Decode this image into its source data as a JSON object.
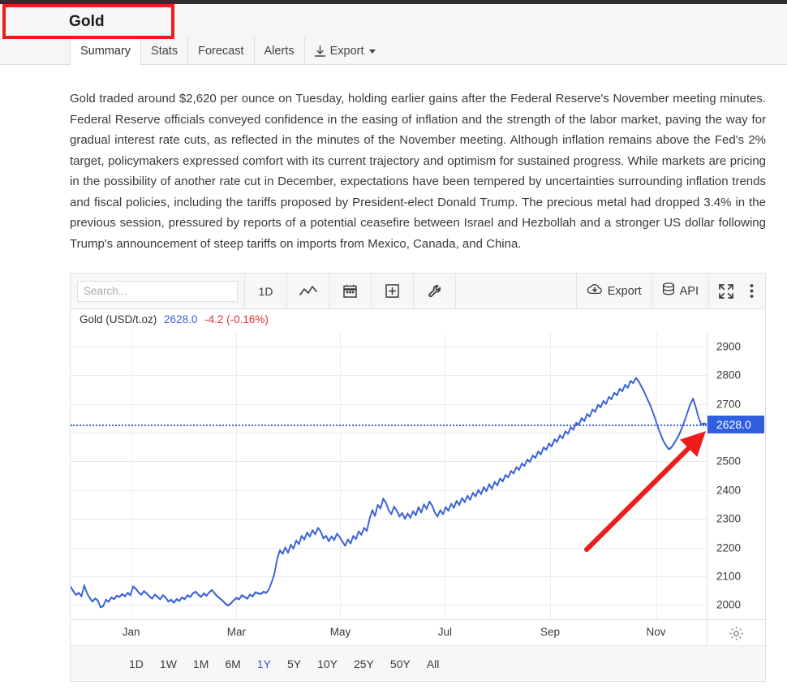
{
  "header": {
    "title": "Gold"
  },
  "tabs": [
    {
      "label": "Summary",
      "active": true
    },
    {
      "label": "Stats",
      "active": false
    },
    {
      "label": "Forecast",
      "active": false
    },
    {
      "label": "Alerts",
      "active": false
    },
    {
      "label": "Export",
      "active": false,
      "icon": "download-icon",
      "caret": true
    }
  ],
  "article": {
    "body": "Gold traded around $2,620 per ounce on Tuesday, holding earlier gains after the Federal Reserve's November meeting minutes. Federal Reserve officials conveyed confidence in the easing of inflation and the strength of the labor market, paving the way for gradual interest rate cuts, as reflected in the minutes of the November meeting. Although inflation remains above the Fed's 2% target, policymakers expressed comfort with its current trajectory and optimism for sustained progress. While markets are pricing in the possibility of another rate cut in December, expectations have been tempered by uncertainties surrounding inflation trends and fiscal policies, including the tariffs proposed by President-elect Donald Trump. The precious metal had dropped 3.4% in the previous session, pressured by reports of a potential ceasefire between Israel and Hezbollah and a stronger US dollar following Trump's announcement of steep tariffs on imports from Mexico, Canada, and China."
  },
  "chart_toolbar": {
    "search_placeholder": "Search...",
    "search_value": "",
    "interval_label": "1D",
    "icons": [
      "line-chart-icon",
      "calendar-icon",
      "plus-box-icon",
      "wrench-icon"
    ],
    "export_label": "Export",
    "export_icon": "cloud-download-icon",
    "api_label": "API",
    "api_icon": "database-icon",
    "fullscreen_icon": "fullscreen-icon",
    "more_icon": "more-vertical-icon"
  },
  "legend": {
    "name": "Gold (USD/t.oz)",
    "price": "2628.0",
    "change": "-4.2 (-0.16%)"
  },
  "ranges": [
    {
      "label": "1D",
      "active": false
    },
    {
      "label": "1W",
      "active": false
    },
    {
      "label": "1M",
      "active": false
    },
    {
      "label": "6M",
      "active": false
    },
    {
      "label": "1Y",
      "active": true
    },
    {
      "label": "5Y",
      "active": false
    },
    {
      "label": "10Y",
      "active": false
    },
    {
      "label": "25Y",
      "active": false
    },
    {
      "label": "50Y",
      "active": false
    },
    {
      "label": "All",
      "active": false
    }
  ],
  "settings_icon": "gear-icon",
  "annotations": {
    "highlight_rect_color": "#ee1c1c",
    "arrow_color": "#ee1c1c"
  },
  "colors": {
    "line": "#3c62d6",
    "accent": "#2f5fe0",
    "negative": "#e03131",
    "badge_bg": "#2f5fe0"
  },
  "chart_data": {
    "type": "line",
    "title": "Gold (USD/t.oz)",
    "xlabel": "",
    "ylabel": "USD/t.oz",
    "ylim": [
      1950,
      2950
    ],
    "yticks": [
      2900,
      2800,
      2700,
      2500,
      2400,
      2300,
      2200,
      2100,
      2000
    ],
    "marker_line": {
      "value": 2628.0,
      "label": "2628.0",
      "style": "dotted"
    },
    "grid": true,
    "legend_position": "top-left",
    "xticks": [
      "Jan",
      "Mar",
      "May",
      "Jul",
      "Sep",
      "Nov"
    ],
    "series": [
      {
        "name": "Gold (USD/t.oz)",
        "color": "#3c62d6",
        "values": [
          2063,
          2048,
          2035,
          2042,
          2030,
          2068,
          2042,
          2025,
          2012,
          2022,
          2016,
          1992,
          1996,
          2018,
          2011,
          2026,
          2020,
          2032,
          2028,
          2038,
          2030,
          2042,
          2034,
          2064,
          2056,
          2044,
          2036,
          2048,
          2040,
          2030,
          2022,
          2036,
          2028,
          2020,
          2034,
          2026,
          2012,
          2018,
          2008,
          2020,
          2014,
          2026,
          2020,
          2034,
          2028,
          2040,
          2046,
          2036,
          2028,
          2040,
          2032,
          2044,
          2052,
          2040,
          2030,
          2022,
          2014,
          2004,
          1998,
          2006,
          2016,
          2024,
          2020,
          2034,
          2028,
          2022,
          2036,
          2030,
          2044,
          2040,
          2038,
          2046,
          2042,
          2056,
          2080,
          2110,
          2160,
          2190,
          2178,
          2200,
          2182,
          2210,
          2196,
          2224,
          2212,
          2240,
          2228,
          2252,
          2238,
          2260,
          2246,
          2268,
          2256,
          2232,
          2240,
          2222,
          2238,
          2226,
          2248,
          2236,
          2220,
          2206,
          2228,
          2214,
          2240,
          2230,
          2256,
          2244,
          2268,
          2258,
          2300,
          2330,
          2310,
          2348,
          2336,
          2370,
          2356,
          2330,
          2316,
          2342,
          2328,
          2308,
          2320,
          2300,
          2318,
          2304,
          2326,
          2312,
          2340,
          2322,
          2350,
          2334,
          2360,
          2346,
          2322,
          2308,
          2330,
          2316,
          2340,
          2328,
          2352,
          2338,
          2362,
          2348,
          2372,
          2358,
          2380,
          2366,
          2390,
          2378,
          2400,
          2386,
          2410,
          2396,
          2420,
          2404,
          2428,
          2416,
          2440,
          2430,
          2452,
          2444,
          2466,
          2458,
          2480,
          2470,
          2492,
          2484,
          2506,
          2498,
          2520,
          2512,
          2534,
          2524,
          2548,
          2540,
          2562,
          2552,
          2576,
          2568,
          2590,
          2580,
          2604,
          2596,
          2618,
          2610,
          2634,
          2628,
          2650,
          2640,
          2664,
          2656,
          2680,
          2672,
          2696,
          2688,
          2710,
          2700,
          2724,
          2716,
          2738,
          2730,
          2752,
          2744,
          2766,
          2756,
          2780,
          2772,
          2790,
          2778,
          2760,
          2742,
          2720,
          2700,
          2676,
          2650,
          2620,
          2596,
          2572,
          2556,
          2542,
          2548,
          2562,
          2578,
          2596,
          2618,
          2644,
          2672,
          2700,
          2718,
          2688,
          2652,
          2628,
          2632,
          2628
        ]
      }
    ]
  }
}
